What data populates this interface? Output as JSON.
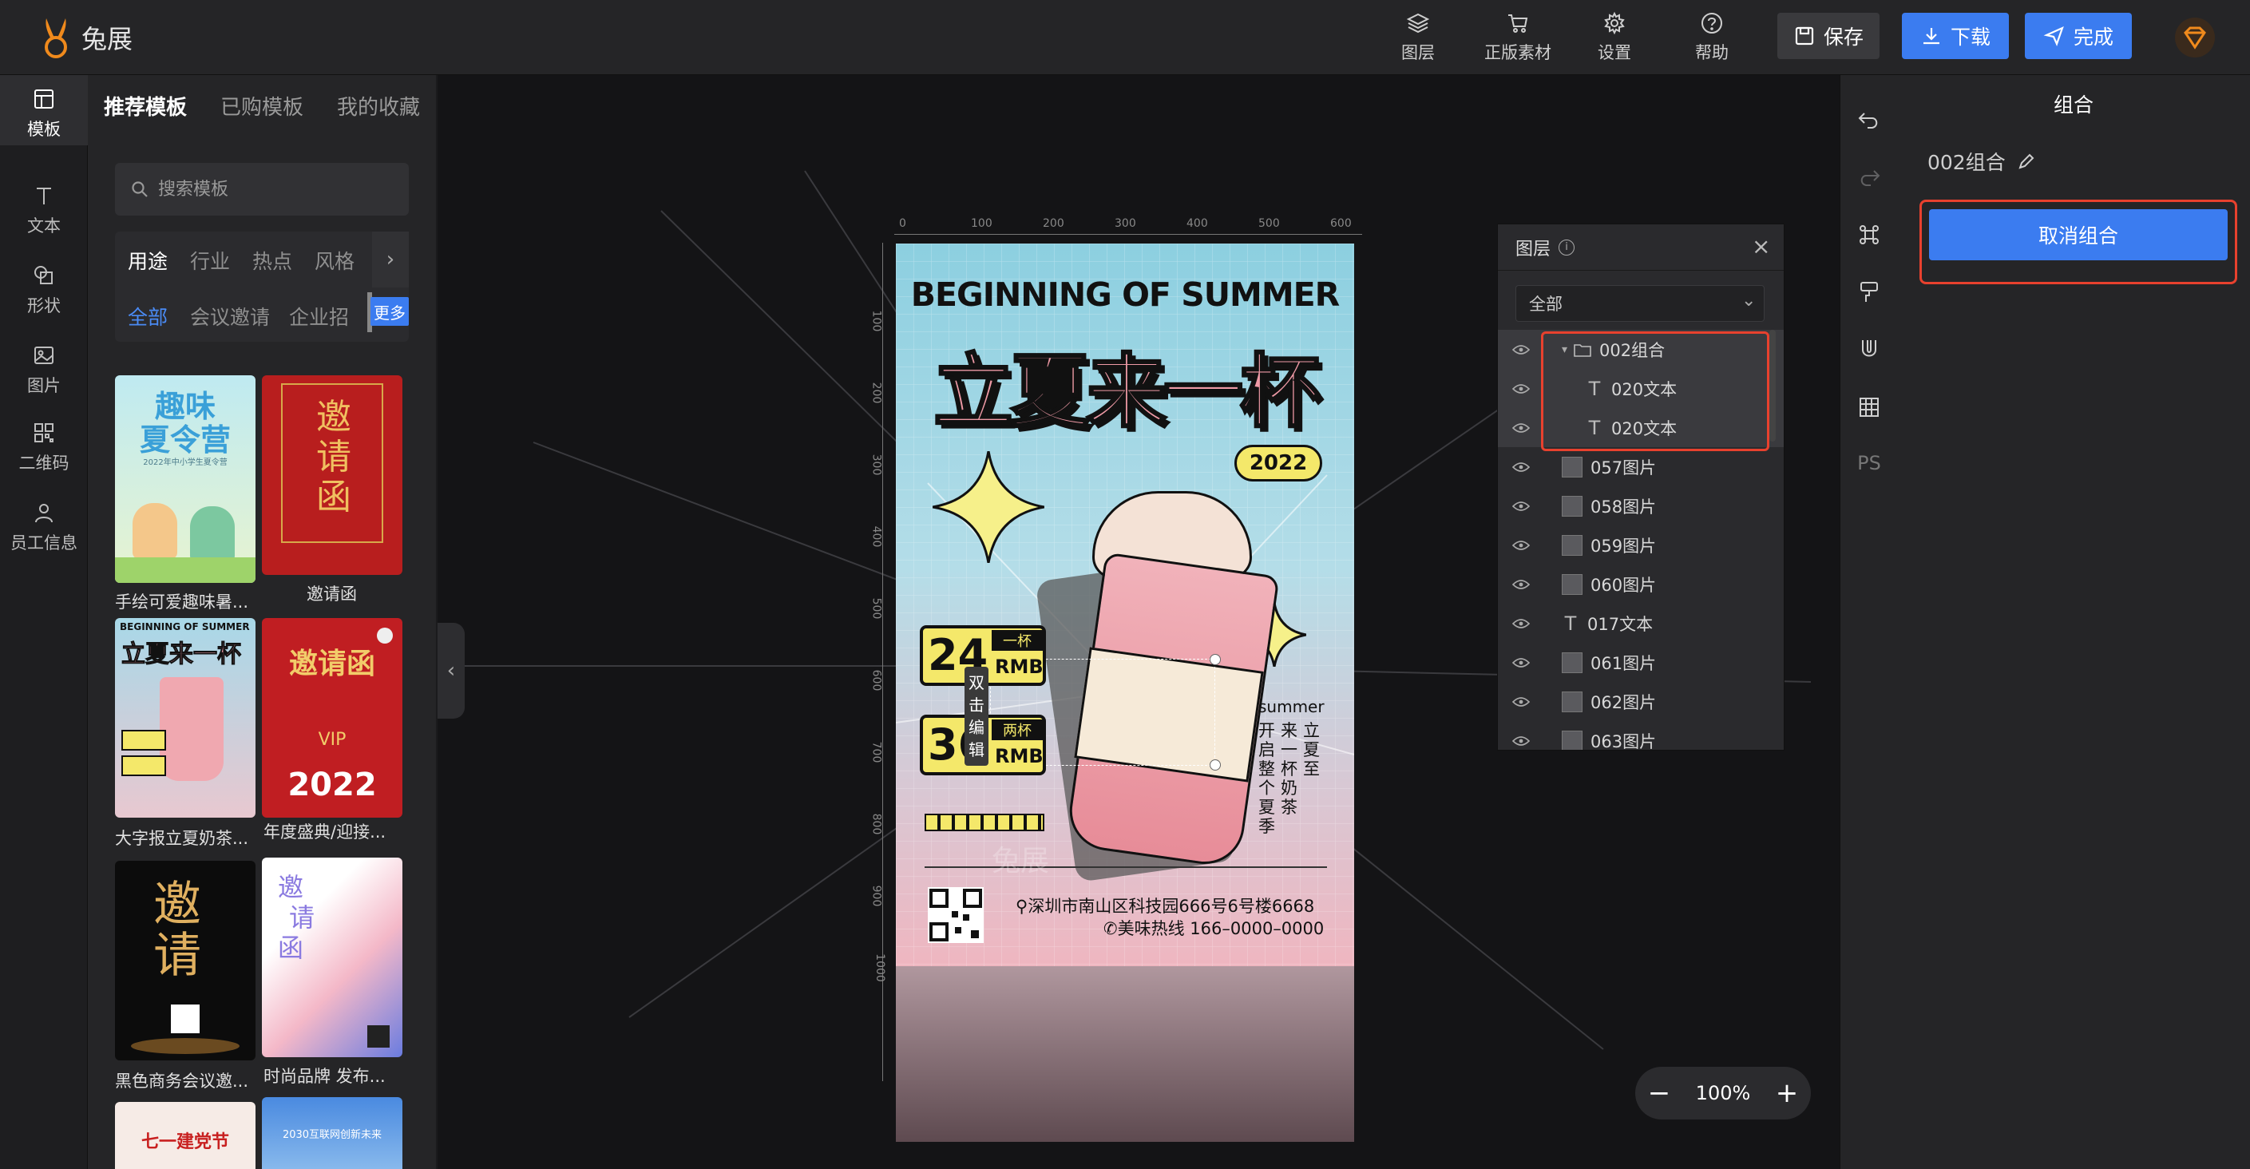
{
  "app": {
    "brand": "兔展"
  },
  "topbar": {
    "items": [
      {
        "label": "图层",
        "icon": "layers-icon"
      },
      {
        "label": "正版素材",
        "icon": "cart-icon"
      },
      {
        "label": "设置",
        "icon": "gear-icon"
      },
      {
        "label": "帮助",
        "icon": "help-icon"
      }
    ],
    "save_label": "保存",
    "download_label": "下载",
    "done_label": "完成"
  },
  "rail": {
    "items": [
      {
        "label": "模板",
        "icon": "template-icon",
        "active": true
      },
      {
        "label": "文本",
        "icon": "text-icon"
      },
      {
        "label": "形状",
        "icon": "shape-icon"
      },
      {
        "label": "图片",
        "icon": "image-icon"
      },
      {
        "label": "二维码",
        "icon": "qrcode-icon"
      },
      {
        "label": "员工信息",
        "icon": "user-icon"
      }
    ]
  },
  "template_panel": {
    "tabs": [
      "推荐模板",
      "已购模板",
      "我的收藏"
    ],
    "search_placeholder": "搜索模板",
    "filter_tabs": [
      "用途",
      "行业",
      "热点",
      "风格"
    ],
    "filter_subs": [
      "全部",
      "会议邀请",
      "企业招"
    ],
    "more_label": "更多",
    "templates": [
      {
        "caption": "手绘可爱趣味暑...",
        "t1": "趣味",
        "t2": "夏令营",
        "small": "2022年中小学生夏令营"
      },
      {
        "caption": "邀请函",
        "t1": "邀",
        "t2": "请",
        "t3": "函"
      },
      {
        "caption": "大字报立夏奶茶...",
        "t1": "BEGINNING OF SUMMER",
        "t2": "立夏来一杯"
      },
      {
        "caption": "年度盛典/迎接...",
        "t1": "邀请函",
        "t2": "VIP",
        "t3": "2022"
      },
      {
        "caption": "黑色商务会议邀...",
        "t1": "邀",
        "t2": "请"
      },
      {
        "caption": "时尚品牌 发布...",
        "t1": "邀",
        "t2": "请",
        "t3": "函"
      },
      {
        "caption": "",
        "t1": "七一建党节"
      },
      {
        "caption": "",
        "t1": "2030互联网创新未来"
      }
    ]
  },
  "canvas": {
    "ruler_h": [
      "0",
      "100",
      "200",
      "300",
      "400",
      "500",
      "600"
    ],
    "ruler_v": [
      "100",
      "200",
      "300",
      "400",
      "500",
      "600",
      "700",
      "800",
      "900",
      "1000"
    ],
    "poster": {
      "headline_en": "BEGINNING OF SUMMER",
      "headline_cn": "立夏来一杯",
      "year_badge": "2022",
      "price1_num": "24",
      "price1_top": "一杯",
      "price1_unit": "RMB",
      "price2_num": "36",
      "price2_top": "两杯",
      "price2_unit": "RMB",
      "edit_hint": "双击编辑",
      "side_en": "summer",
      "side_col1": "立夏至",
      "side_col2": "来一杯奶茶",
      "side_col3": "开启整个夏季",
      "address": "深圳市南山区科技园666号6号楼6668",
      "hotline": "美味热线 166–0000–0000",
      "watermark": "兔展"
    },
    "zoom_label": "100%"
  },
  "layers_panel": {
    "title": "图层",
    "filter_value": "全部",
    "rows": [
      {
        "name": "002组合",
        "type": "group",
        "level": 0
      },
      {
        "name": "020文本",
        "type": "text",
        "level": 1
      },
      {
        "name": "020文本",
        "type": "text",
        "level": 1
      },
      {
        "name": "057图片",
        "type": "image",
        "level": 0
      },
      {
        "name": "058图片",
        "type": "image",
        "level": 0
      },
      {
        "name": "059图片",
        "type": "image",
        "level": 0
      },
      {
        "name": "060图片",
        "type": "image",
        "level": 0
      },
      {
        "name": "017文本",
        "type": "text",
        "level": 0
      },
      {
        "name": "061图片",
        "type": "image",
        "level": 0
      },
      {
        "name": "062图片",
        "type": "image",
        "level": 0
      },
      {
        "name": "063图片",
        "type": "image",
        "level": 0
      }
    ]
  },
  "tools": {
    "ps_label": "PS"
  },
  "props": {
    "title": "组合",
    "element_name": "002组合",
    "ungroup_label": "取消组合"
  },
  "colors": {
    "accent": "#3b7cf0",
    "highlight": "#e8412e",
    "brand_orange": "#f08a1c"
  }
}
